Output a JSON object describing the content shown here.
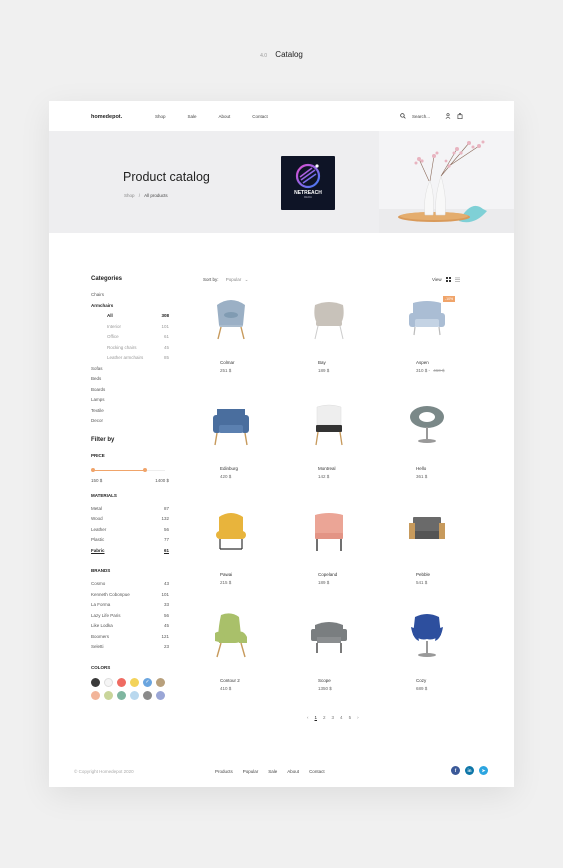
{
  "page": {
    "number": "4.0",
    "title": "Catalog"
  },
  "nav": {
    "logo": "homedepot.",
    "links": [
      "Shop",
      "Sale",
      "About",
      "Contact"
    ],
    "search": "Search..."
  },
  "hero": {
    "title": "Product catalog",
    "breadcrumb": [
      "Shop",
      "All products"
    ],
    "badge_text": "NETREACH",
    "badge_sub": "MEDIA"
  },
  "sidebar": {
    "categories_title": "Categories",
    "categories": [
      {
        "label": "Chairs"
      },
      {
        "label": "Armchairs",
        "active": true,
        "children": [
          {
            "label": "All",
            "count": "308",
            "active": true
          },
          {
            "label": "Interior",
            "count": "101"
          },
          {
            "label": "Office",
            "count": "61"
          },
          {
            "label": "Rocking chairs",
            "count": "45"
          },
          {
            "label": "Leather armchairs",
            "count": "85"
          }
        ]
      },
      {
        "label": "Sofas"
      },
      {
        "label": "Beds"
      },
      {
        "label": "Boards"
      },
      {
        "label": "Lamps"
      },
      {
        "label": "Textile"
      },
      {
        "label": "Decor"
      }
    ],
    "filter_title": "Filter by",
    "price_label": "PRICE",
    "price_min": "150 $",
    "price_max": "1400 $",
    "price_low_fraction": 0.0,
    "price_high_fraction": 0.73,
    "materials_label": "MATERIALS",
    "materials": [
      {
        "label": "Metal",
        "count": "87"
      },
      {
        "label": "Wood",
        "count": "132"
      },
      {
        "label": "Leather",
        "count": "56"
      },
      {
        "label": "Plastic",
        "count": "77"
      },
      {
        "label": "Fabric",
        "count": "61",
        "active": true
      }
    ],
    "brands_label": "BRANDS",
    "brands": [
      {
        "label": "Cosmo",
        "count": "43"
      },
      {
        "label": "Kenneth Cobonpue",
        "count": "101"
      },
      {
        "label": "La Forma",
        "count": "33"
      },
      {
        "label": "Lazy Life Paris",
        "count": "56"
      },
      {
        "label": "Like Lodka",
        "count": "45"
      },
      {
        "label": "Boomers",
        "count": "121"
      },
      {
        "label": "Seletti",
        "count": "23"
      }
    ],
    "colors_label": "COLORS",
    "colors": [
      "#3a3a3a",
      "#f5f5f5",
      "#ef6b62",
      "#f3d35a",
      "#6aa5df",
      "#b8a07c",
      "#f2b59a",
      "#c9d59a",
      "#7fb6a0",
      "#b9d8ee",
      "#8a8a8a",
      "#9aa6d6"
    ],
    "selected_color_index": 4
  },
  "toolbar": {
    "sort_label": "Sort by:",
    "sort_value": "Popular",
    "view_label": "View"
  },
  "products": [
    {
      "name": "Colmar",
      "price": "251 $",
      "color": "#9bb0c5",
      "leg": "#c79a5c"
    },
    {
      "name": "Bay",
      "price": "189 $",
      "color": "#c8c2ba",
      "leg": "#cccccc"
    },
    {
      "name": "Aspen",
      "price": "310 $",
      "old_price": "460 $",
      "sale": "-10%",
      "color": "#aabdd4",
      "leg": "#bbbbbb"
    },
    {
      "name": "Edinburg",
      "price": "420 $",
      "color": "#4a6e9e",
      "leg": "#c79a5c"
    },
    {
      "name": "Montreal",
      "price": "142 $",
      "color": "#eeeeee",
      "leg": "#c79a5c"
    },
    {
      "name": "Hello",
      "price": "361 $",
      "color": "#7a8888",
      "leg": "#999999"
    },
    {
      "name": "Pawai",
      "price": "215 $",
      "color": "#e8b43c",
      "leg": "#333333"
    },
    {
      "name": "Copeland",
      "price": "189 $",
      "color": "#eba596",
      "leg": "#333333"
    },
    {
      "name": "Pebble",
      "price": "541 $",
      "color": "#6a6a6a",
      "leg": "#c79a5c"
    },
    {
      "name": "Contour 2",
      "price": "410 $",
      "color": "#a9c06a",
      "leg": "#c79a5c"
    },
    {
      "name": "Scope",
      "price": "1350 $",
      "color": "#7a7e80",
      "leg": "#333333"
    },
    {
      "name": "Cozy",
      "price": "689 $",
      "color": "#2d4f9e",
      "leg": "#999999"
    }
  ],
  "pagination": {
    "pages": [
      "1",
      "2",
      "3",
      "4",
      "5"
    ],
    "current": "1"
  },
  "footer": {
    "copyright": "© Copyright Homedepot 2020",
    "links": [
      "Products",
      "Popular",
      "Sale",
      "About",
      "Contact"
    ],
    "socials": [
      {
        "icon": "facebook-icon",
        "letter": "f",
        "color": "#3b5998"
      },
      {
        "icon": "linkedin-icon",
        "letter": "in",
        "color": "#0e76a8"
      },
      {
        "icon": "telegram-icon",
        "letter": "➤",
        "color": "#2ca5e0"
      }
    ]
  }
}
